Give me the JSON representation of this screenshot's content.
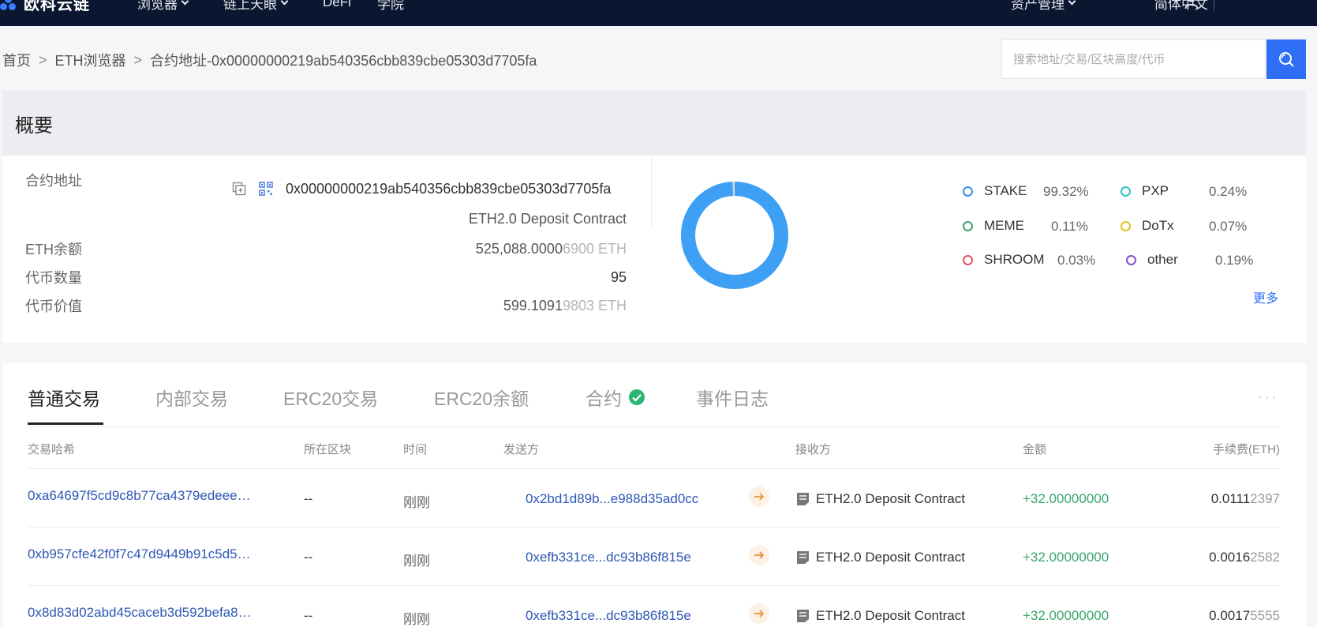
{
  "nav": {
    "logo_text": "欧科云链",
    "items": [
      {
        "label": "浏览器"
      },
      {
        "label": "链上天眼"
      },
      {
        "label": "DeFi"
      },
      {
        "label": "学院"
      }
    ],
    "asset_mgmt": "资产管理",
    "language": "简体中文"
  },
  "breadcrumb": {
    "home": "首页",
    "sep": ">",
    "eth": "ETH浏览器",
    "current": "合约地址-0x00000000219ab540356cbb839cbe05303d7705fa"
  },
  "search": {
    "placeholder": "搜索地址/交易/区块高度/代币"
  },
  "overview": {
    "title": "概要",
    "contract_label": "合约地址",
    "contract_address": "0x00000000219ab540356cbb839cbe05303d7705fa",
    "contract_name": "ETH2.0 Deposit Contract",
    "eth_balance_label": "ETH余额",
    "eth_balance_main": "525,088.0000",
    "eth_balance_dim": "6900 ETH",
    "token_count_label": "代币数量",
    "token_count": "95",
    "token_value_label": "代币价值",
    "token_value_main": "599.1091",
    "token_value_dim": "9803 ETH",
    "more": "更多",
    "legend": [
      {
        "name": "STAKE",
        "pct": "99.32%",
        "color": "#3a8ee6"
      },
      {
        "name": "PXP",
        "pct": "0.24%",
        "color": "#2ec4c4"
      },
      {
        "name": "MEME",
        "pct": "0.11%",
        "color": "#3aa76d"
      },
      {
        "name": "DoTx",
        "pct": "0.07%",
        "color": "#e6c21a"
      },
      {
        "name": "SHROOM",
        "pct": "0.03%",
        "color": "#e05561"
      },
      {
        "name": "other",
        "pct": "0.19%",
        "color": "#8a4fc9"
      }
    ],
    "donut": {
      "main_color": "#3da0f5",
      "main_fraction": 0.9932
    }
  },
  "tabs": {
    "normal": "普通交易",
    "internal": "内部交易",
    "erc20_tx": "ERC20交易",
    "erc20_balance": "ERC20余额",
    "contract": "合约",
    "events": "事件日志",
    "more": "···"
  },
  "table": {
    "headers": {
      "hash": "交易哈希",
      "block": "所在区块",
      "time": "时间",
      "from": "发送方",
      "to": "接收方",
      "amount": "金额",
      "fee": "手续费(ETH)"
    },
    "rows": [
      {
        "hash": "0xa64697f5cd9c8b77ca4379edeee…",
        "block": "--",
        "time": "刚刚",
        "from": "0x2bd1d89b...e988d35ad0cc",
        "to": "ETH2.0 Deposit Contract",
        "amount": "+32.00000000",
        "fee_main": "0.0111",
        "fee_dim": "2397"
      },
      {
        "hash": "0xb957cfe42f0f7c47d9449b91c5d5…",
        "block": "--",
        "time": "刚刚",
        "from": "0xefb331ce...dc93b86f815e",
        "to": "ETH2.0 Deposit Contract",
        "amount": "+32.00000000",
        "fee_main": "0.0016",
        "fee_dim": "2582"
      },
      {
        "hash": "0x8d83d02abd45caceb3d592befa8…",
        "block": "--",
        "time": "刚刚",
        "from": "0xefb331ce...dc93b86f815e",
        "to": "ETH2.0 Deposit Contract",
        "amount": "+32.00000000",
        "fee_main": "0.0017",
        "fee_dim": "5555"
      }
    ]
  }
}
